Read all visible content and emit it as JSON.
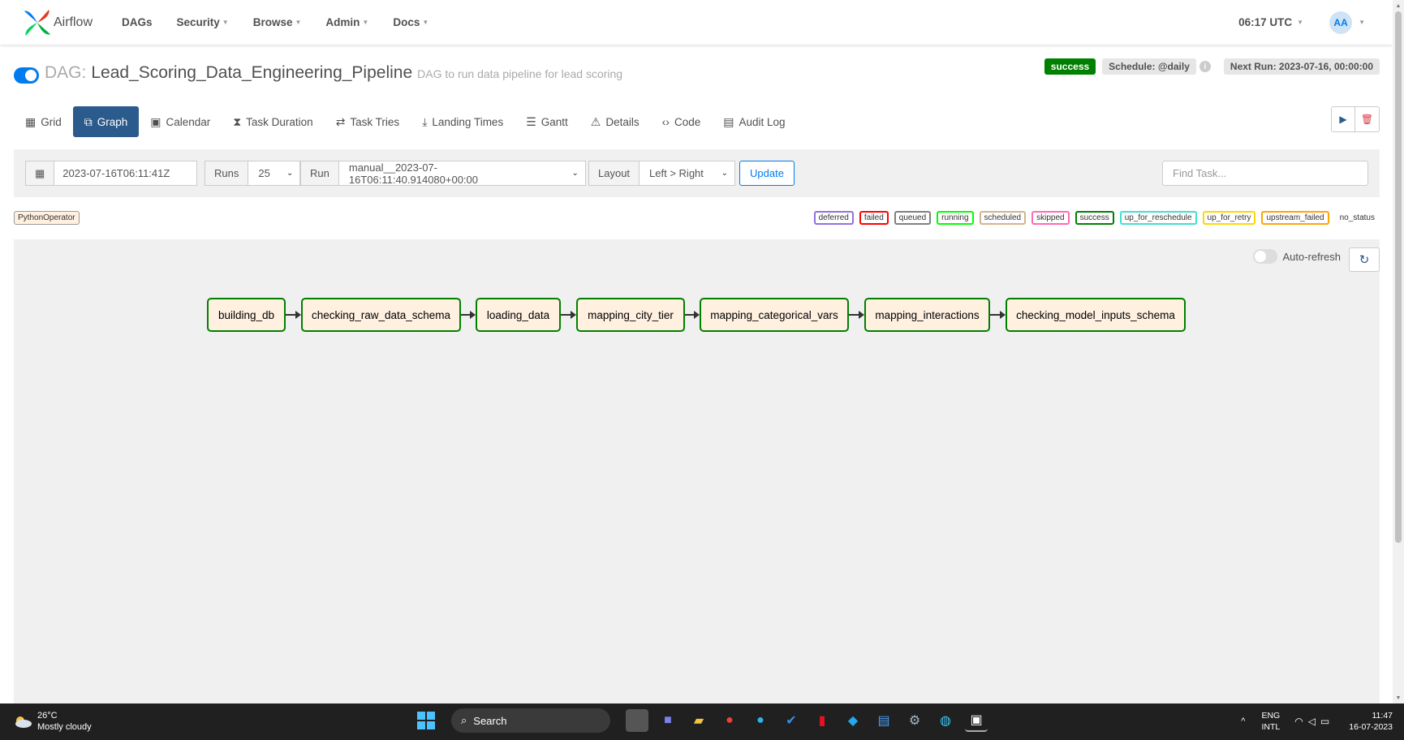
{
  "nav": {
    "brand": "Airflow",
    "items": [
      {
        "label": "DAGs"
      },
      {
        "label": "Security"
      },
      {
        "label": "Browse"
      },
      {
        "label": "Admin"
      },
      {
        "label": "Docs"
      }
    ],
    "time": "06:17 UTC",
    "user_initials": "AA"
  },
  "dag": {
    "prefix": "DAG:",
    "name": "Lead_Scoring_Data_Engineering_Pipeline",
    "description": "DAG to run data pipeline for lead scoring",
    "status": "success",
    "schedule": "Schedule: @daily",
    "next_run": "Next Run: 2023-07-16, 00:00:00"
  },
  "tabs": [
    {
      "label": "Grid",
      "icon": "grid-icon"
    },
    {
      "label": "Graph",
      "icon": "graph-icon",
      "active": true
    },
    {
      "label": "Calendar",
      "icon": "calendar-icon"
    },
    {
      "label": "Task Duration",
      "icon": "hourglass-icon"
    },
    {
      "label": "Task Tries",
      "icon": "retry-icon"
    },
    {
      "label": "Landing Times",
      "icon": "landing-icon"
    },
    {
      "label": "Gantt",
      "icon": "gantt-icon"
    },
    {
      "label": "Details",
      "icon": "details-icon"
    },
    {
      "label": "Code",
      "icon": "code-icon"
    },
    {
      "label": "Audit Log",
      "icon": "audit-icon"
    }
  ],
  "filters": {
    "base_date": "2023-07-16T06:11:41Z",
    "runs_label": "Runs",
    "runs_value": "25",
    "run_label": "Run",
    "run_value": "manual__2023-07-16T06:11:40.914080+00:00",
    "layout_label": "Layout",
    "layout_value": "Left > Right",
    "update_label": "Update",
    "find_placeholder": "Find Task..."
  },
  "legend": {
    "operator": "PythonOperator",
    "statuses": [
      {
        "label": "deferred",
        "color": "#9370db"
      },
      {
        "label": "failed",
        "color": "#ff0000"
      },
      {
        "label": "queued",
        "color": "#808080"
      },
      {
        "label": "running",
        "color": "#00ff00"
      },
      {
        "label": "scheduled",
        "color": "#d2b48c"
      },
      {
        "label": "skipped",
        "color": "#ff69b4"
      },
      {
        "label": "success",
        "color": "#008000"
      },
      {
        "label": "up_for_reschedule",
        "color": "#40e0d0"
      },
      {
        "label": "up_for_retry",
        "color": "#ffd700"
      },
      {
        "label": "upstream_failed",
        "color": "#ffa500"
      },
      {
        "label": "no_status",
        "color": ""
      }
    ]
  },
  "graph": {
    "auto_refresh_label": "Auto-refresh",
    "tasks": [
      {
        "label": "building_db",
        "status": "success"
      },
      {
        "label": "checking_raw_data_schema",
        "status": "success"
      },
      {
        "label": "loading_data",
        "status": "success"
      },
      {
        "label": "mapping_city_tier",
        "status": "success"
      },
      {
        "label": "mapping_categorical_vars",
        "status": "success"
      },
      {
        "label": "mapping_interactions",
        "status": "success"
      },
      {
        "label": "checking_model_inputs_schema",
        "status": "success"
      }
    ]
  },
  "taskbar": {
    "temperature": "26°C",
    "weather": "Mostly cloudy",
    "search_label": "Search",
    "lang_line1": "ENG",
    "lang_line2": "INTL",
    "time": "11:47",
    "date": "16-07-2023"
  }
}
